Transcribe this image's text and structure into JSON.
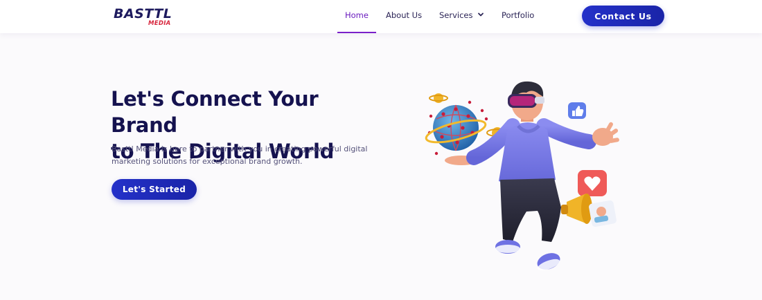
{
  "brand": {
    "logo_main": "BASTTL",
    "logo_sub": "MEDIA"
  },
  "nav": {
    "items": [
      {
        "label": "Home",
        "active": true
      },
      {
        "label": "About Us"
      },
      {
        "label": "Services",
        "has_dropdown": true
      },
      {
        "label": "Portfolio"
      }
    ],
    "contact_label": "Contact Us"
  },
  "hero": {
    "title_line1": "Let's Connect Your Brand",
    "title_line2": "to The Digital World",
    "description_line1": "Basttl Media is here to partner with you in creating powerful digital",
    "description_line2": "marketing solutions for exceptional brand growth.",
    "cta_label": "Let's  Started"
  },
  "colors": {
    "accent_purple": "#7a1fc9",
    "button_blue": "#2431c9",
    "heading_navy": "#15124f",
    "logo_red": "#d7263d"
  },
  "icons": {
    "services_dropdown": "chevron-down-icon",
    "illustration": "vr-person-with-globe-illustration",
    "like": "thumbs-up-icon",
    "heart": "heart-icon",
    "megaphone": "megaphone-icon"
  }
}
